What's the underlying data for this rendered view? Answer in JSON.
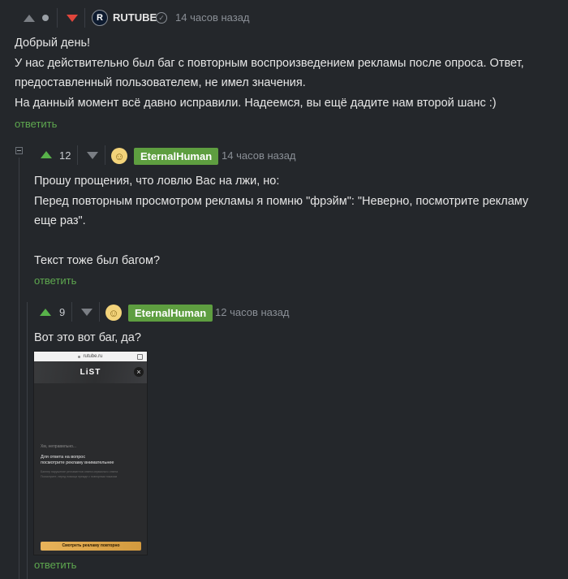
{
  "comment1": {
    "author": "RUTUBE",
    "avatar_letter": "R",
    "time": "14 часов назад",
    "lines": [
      "Добрый день!",
      "У нас действительно был баг с повторным воспроизведением рекламы после опроса. Ответ,",
      "предоставленный пользователем, не имел значения.",
      "На данный момент всё давно исправили. Надеемся, вы ещё дадите нам второй шанс :)"
    ],
    "reply_label": "ответить"
  },
  "comment2": {
    "rating": "12",
    "author": "EternalHuman",
    "time": "14 часов назад",
    "lines": [
      "Прошу прощения, что ловлю Вас на лжи, но:",
      "Перед повторным просмотром рекламы я помню \"фрэйм\": \"Неверно, посмотрите рекламу",
      "еще раз\".",
      "",
      "Текст тоже был багом?"
    ],
    "reply_label": "ответить"
  },
  "comment3": {
    "rating": "9",
    "author": "EternalHuman",
    "time": "12 часов назад",
    "text": "Вот это вот баг, да?",
    "reply_label": "ответить",
    "screenshot": {
      "url": "rutube.ru",
      "logo": "LiST",
      "close": "×",
      "small_text": "Хм, неправильно...",
      "answer_line1": "Для ответа на вопрос",
      "answer_line2": "посмотрите рекламу внимательнее",
      "hint_line1": "Баннер нарушение регламентов ответа сервисного ответа",
      "hint_line2": "Посмотрите, перед помощи прежде с повторным показом",
      "button": "Смотреть рекламу повторно"
    }
  },
  "colors": {
    "background": "#24272b",
    "author_badge": "#5e9e40",
    "reply": "#5ea84f",
    "upvote": "#58b24a",
    "downvote": "#e0463c"
  }
}
